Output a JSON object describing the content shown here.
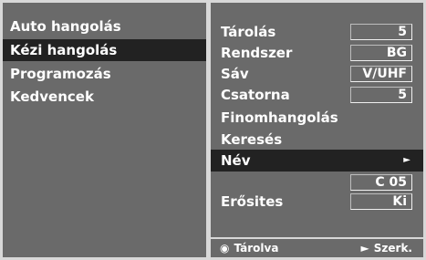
{
  "left_menu": {
    "items": [
      {
        "label": "Auto hangolás",
        "active": false
      },
      {
        "label": "Kézi hangolás",
        "active": true
      },
      {
        "label": "Programozás",
        "active": false
      },
      {
        "label": "Kedvencek",
        "active": false
      }
    ]
  },
  "settings": {
    "tarolas": {
      "label": "Tárolás",
      "value": "5"
    },
    "rendszer": {
      "label": "Rendszer",
      "value": "BG"
    },
    "sav": {
      "label": "Sáv",
      "value": "V/UHF"
    },
    "csatorna": {
      "label": "Csatorna",
      "value": "5"
    },
    "finomhangolas": {
      "label": "Finomhangolás"
    },
    "kereses": {
      "label": "Keresés"
    },
    "nev": {
      "label": "Név",
      "icon": "right-arrow-icon"
    },
    "nev_value": {
      "value": "C 05"
    },
    "erosites": {
      "label": "Erősites",
      "value": "Ki"
    }
  },
  "footer": {
    "store": {
      "icon": "record-button-icon",
      "label": "Tárolva"
    },
    "edit": {
      "icon": "right-arrow-icon",
      "label": "Szerk."
    }
  },
  "colors": {
    "panel": "#6a6a6a",
    "frame": "#d8d8d8",
    "highlight": "#222222",
    "text": "#ffffff"
  }
}
